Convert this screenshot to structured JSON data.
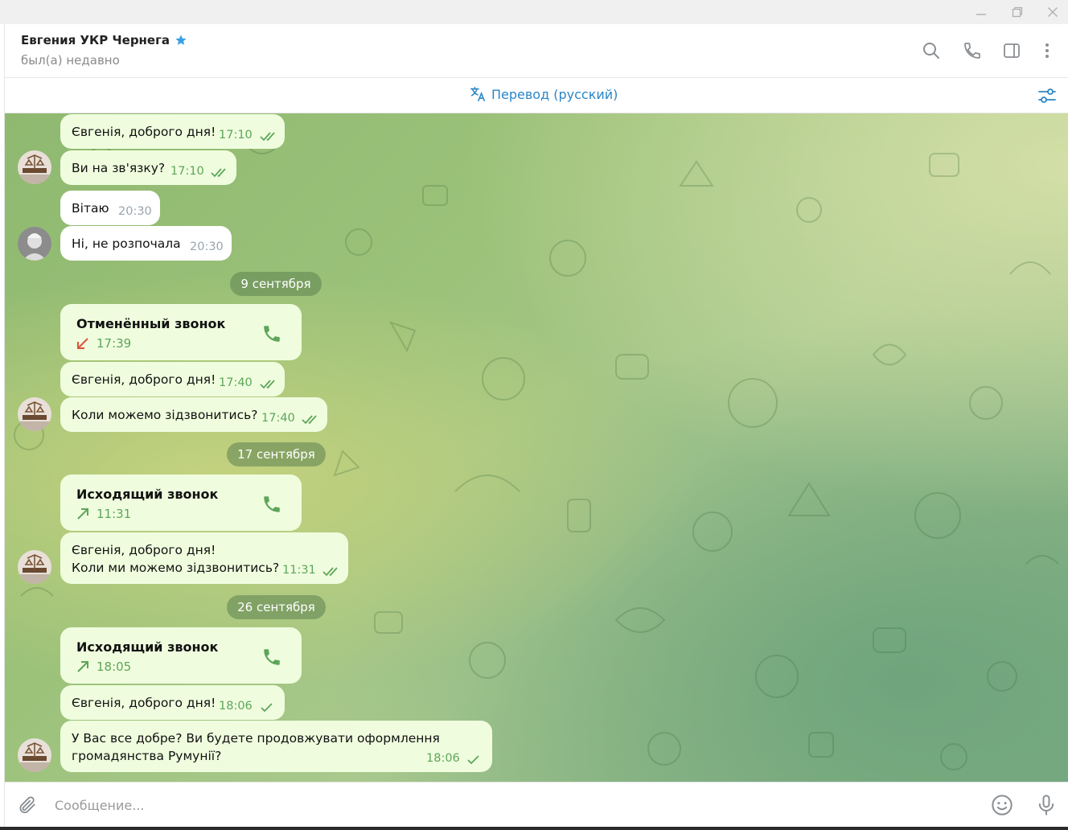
{
  "window": {
    "minimize_icon": "minimize-icon",
    "restore_icon": "restore-icon",
    "close_icon": "close-icon"
  },
  "header": {
    "name": "Евгения УКР Чернега",
    "status": "был(а) недавно",
    "icons": [
      "search-icon",
      "phone-icon",
      "sidebar-icon",
      "more-icon"
    ]
  },
  "translate": {
    "label": "Перевод (русский)"
  },
  "messages": {
    "m1": {
      "text": "Євгенія, доброго дня!",
      "time": "17:10"
    },
    "m2": {
      "text": "Ви на зв'язку?",
      "time": "17:10"
    },
    "m3": {
      "text": "Вітаю",
      "time": "20:30"
    },
    "m4": {
      "text": "Ні, не розпочала",
      "time": "20:30"
    },
    "d1": "9 сентября",
    "c1": {
      "title": "Отменённый звонок",
      "time": "17:39"
    },
    "m5": {
      "text": "Євгенія, доброго дня!",
      "time": "17:40"
    },
    "m6": {
      "text": "Коли можемо зідзвонитись?",
      "time": "17:40"
    },
    "d2": "17 сентября",
    "c2": {
      "title": "Исходящий звонок",
      "time": "11:31"
    },
    "m7": {
      "text": "Євгенія, доброго дня!\nКоли ми можемо зідзвонитись?",
      "time": "11:31"
    },
    "d3": "26 сентября",
    "c3": {
      "title": "Исходящий звонок",
      "time": "18:05"
    },
    "m8": {
      "text": "Євгенія, доброго дня!",
      "time": "18:06"
    },
    "m9": {
      "text": "У Вас все добре? Ви будете продовжувати оформлення\nгромадянства Румунії?",
      "time": "18:06"
    }
  },
  "input": {
    "placeholder": "Сообщение..."
  },
  "colors": {
    "accent": "#2a86c8",
    "outgoing_bubble": "#effdde",
    "time_green": "#5ea55a",
    "missed_red": "#e0533d"
  }
}
